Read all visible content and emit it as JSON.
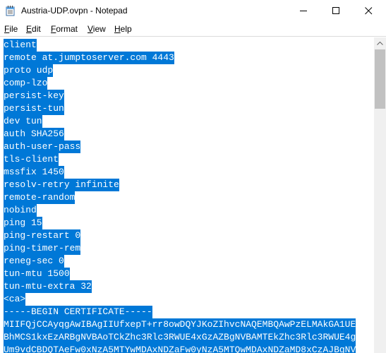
{
  "window": {
    "title": "Austria-UDP.ovpn - Notepad"
  },
  "menu": {
    "file": {
      "key": "F",
      "rest": "ile"
    },
    "edit": {
      "key": "E",
      "rest": "dit"
    },
    "format": {
      "key": "F",
      "rest": "ormat",
      "prefix": ""
    },
    "view": {
      "key": "V",
      "rest": "iew"
    },
    "help": {
      "key": "H",
      "rest": "elp"
    }
  },
  "editor": {
    "lines": [
      "client",
      "remote at.jumptoserver.com 4443",
      "proto udp",
      "comp-lzo",
      "persist-key",
      "persist-tun",
      "dev tun",
      "auth SHA256",
      "auth-user-pass",
      "tls-client",
      "mssfix 1450",
      "resolv-retry infinite",
      "remote-random",
      "nobind",
      "ping 15",
      "ping-restart 0",
      "ping-timer-rem",
      "reneg-sec 0",
      "tun-mtu 1500",
      "tun-mtu-extra 32",
      "<ca>",
      "-----BEGIN CERTIFICATE-----",
      "MIIFQjCCAyqgAwIBAgIIUfxepT+rr8owDQYJKoZIhvcNAQEMBQAwPzELMAkGA1UE",
      "BhMCS1kxEzARBgNVBAoTCkZhc3Rlc3RWUE4xGzAZBgNVBAMTEkZhc3Rlc3RWUE4g",
      "Um9vdCBDQTAeFw0xNzA5MTYwMDAxNDZaFw0yNzA5MTQwMDAxNDZaMD8xCzAJBgNV"
    ],
    "selection": "all"
  },
  "scrollbar": {
    "position": 0
  },
  "colors": {
    "selection_bg": "#0078d7",
    "selection_fg": "#ffffff",
    "scroll_track": "#f0f0f0",
    "scroll_thumb": "#c1c1c1"
  },
  "icons": {
    "app": "notepad-icon",
    "minimize": "minimize-icon",
    "maximize": "maximize-icon",
    "close": "close-icon",
    "scroll_up": "scroll-up-arrow-icon"
  }
}
